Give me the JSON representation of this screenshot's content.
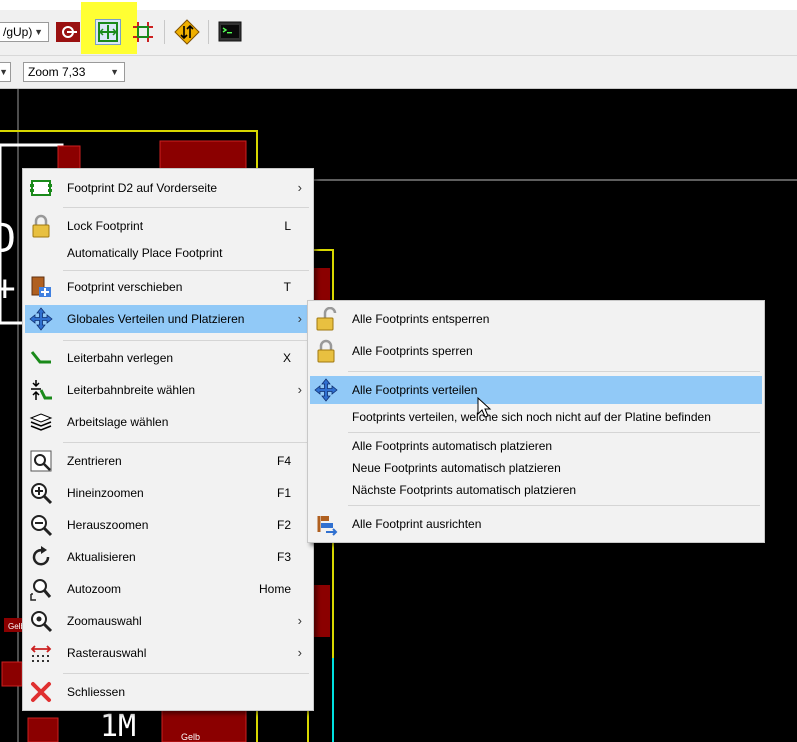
{
  "toolbar": {
    "layer_combo_value": "/gUp)",
    "zoom_combo_value": "Zoom 7,33"
  },
  "board": {
    "ref_text": "1M",
    "small_label_1": "Gelb",
    "small_label_2": "Gelb"
  },
  "context_menu": {
    "items": [
      {
        "label": "Footprint D2 auf Vorderseite",
        "key": "",
        "icon": "footprint-icon"
      },
      {
        "label": "Lock Footprint",
        "key": "L",
        "icon": "lock-icon"
      },
      {
        "label": "Automatically Place Footprint",
        "key": "",
        "icon": ""
      },
      {
        "label": "Footprint verschieben",
        "key": "T",
        "icon": "move-footprint-icon"
      },
      {
        "label": "Globales Verteilen und Platzieren",
        "key": "",
        "icon": "move-arrows-icon"
      },
      {
        "label": "Leiterbahn verlegen",
        "key": "X",
        "icon": "route-track-icon"
      },
      {
        "label": "Leiterbahnbreite wählen",
        "key": "",
        "icon": "track-width-icon"
      },
      {
        "label": "Arbeitslage wählen",
        "key": "",
        "icon": "layers-icon"
      },
      {
        "label": "Zentrieren",
        "key": "F4",
        "icon": "zoom-center-icon"
      },
      {
        "label": "Hineinzoomen",
        "key": "F1",
        "icon": "zoom-in-icon"
      },
      {
        "label": "Herauszoomen",
        "key": "F2",
        "icon": "zoom-out-icon"
      },
      {
        "label": "Aktualisieren",
        "key": "F3",
        "icon": "refresh-icon"
      },
      {
        "label": "Autozoom",
        "key": "Home",
        "icon": "zoom-fit-icon"
      },
      {
        "label": "Zoomauswahl",
        "key": "",
        "icon": "zoom-select-icon"
      },
      {
        "label": "Rasterauswahl",
        "key": "",
        "icon": "grid-icon"
      },
      {
        "label": "Schliessen",
        "key": "",
        "icon": "close-icon"
      }
    ]
  },
  "submenu": {
    "items": [
      {
        "label": "Alle Footprints entsperren",
        "icon": "unlock-icon"
      },
      {
        "label": "Alle Footprints sperren",
        "icon": "lock-icon"
      },
      {
        "label": "Alle Footprints verteilen",
        "icon": "move-arrows-icon"
      },
      {
        "label": "Footprints verteilen, welche sich noch nicht auf der Platine befinden",
        "icon": ""
      },
      {
        "label": "Alle Footprints automatisch platzieren",
        "icon": ""
      },
      {
        "label": "Neue Footprints automatisch platzieren",
        "icon": ""
      },
      {
        "label": "Nächste Footprints automatisch platzieren",
        "icon": ""
      },
      {
        "label": "Alle Footprint ausrichten",
        "icon": "align-icon"
      }
    ]
  },
  "colors": {
    "highlight": "#91c9f7",
    "pad": "#8b0000",
    "outline": "#d8d800",
    "toolbar_highlight": "#ffff33"
  }
}
